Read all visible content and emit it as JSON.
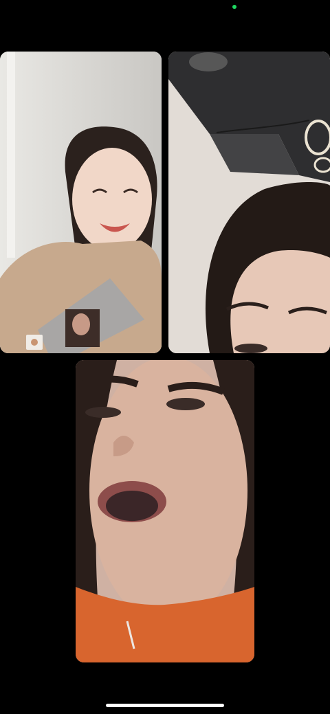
{
  "status_bar": {
    "camera_indicator_color": "#1ed760"
  },
  "call": {
    "participants": [
      {
        "tile": "participant-video-1",
        "background": "#dcdad6"
      },
      {
        "tile": "participant-video-2",
        "background": "#e2dcd6"
      },
      {
        "tile": "participant-video-3",
        "background": "#d9b39f"
      }
    ]
  },
  "home_indicator": {
    "color": "#ffffff"
  }
}
